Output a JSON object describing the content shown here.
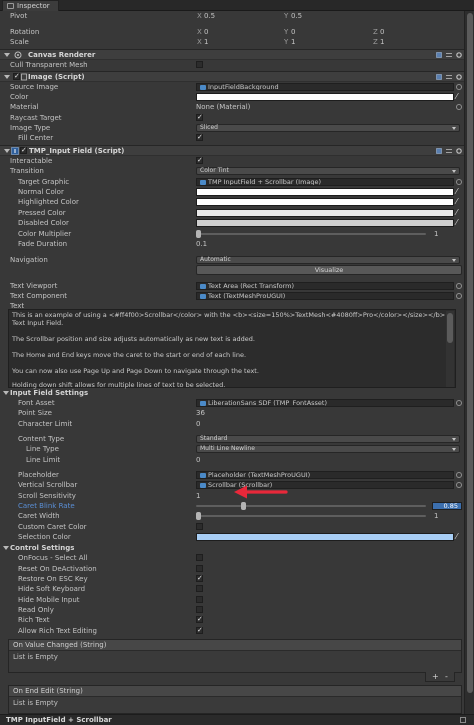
{
  "window": {
    "tab_label": "Inspector"
  },
  "transform": {
    "pivot": {
      "label": "Pivot",
      "x": "0.5",
      "y": "0.5"
    },
    "rotation": {
      "label": "Rotation",
      "x": "0",
      "y": "0",
      "z": "0"
    },
    "scale": {
      "label": "Scale",
      "x": "1",
      "y": "1",
      "z": "1"
    },
    "axis_x": "X",
    "axis_y": "Y",
    "axis_z": "Z"
  },
  "canvas_renderer": {
    "title": "Canvas Renderer",
    "cull_label": "Cull Transparent Mesh"
  },
  "image": {
    "title": "Image (Script)",
    "source_image_label": "Source Image",
    "source_image_value": "InputFieldBackground",
    "color_label": "Color",
    "material_label": "Material",
    "material_value": "None (Material)",
    "raycast_label": "Raycast Target",
    "image_type_label": "Image Type",
    "image_type_value": "Sliced",
    "fill_center_label": "Fill Center"
  },
  "tmp_input": {
    "title": "TMP_Input Field (Script)",
    "interactable_label": "Interactable",
    "transition_label": "Transition",
    "transition_value": "Color Tint",
    "target_graphic_label": "Target Graphic",
    "target_graphic_value": "TMP InputField + Scrollbar (Image)",
    "normal_color_label": "Normal Color",
    "highlighted_color_label": "Highlighted Color",
    "pressed_color_label": "Pressed Color",
    "disabled_color_label": "Disabled Color",
    "color_multiplier_label": "Color Multiplier",
    "color_multiplier_value": "1",
    "fade_duration_label": "Fade Duration",
    "fade_duration_value": "0.1",
    "navigation_label": "Navigation",
    "navigation_value": "Automatic",
    "visualize_label": "Visualize",
    "text_viewport_label": "Text Viewport",
    "text_viewport_value": "Text Area (Rect Transform)",
    "text_component_label": "Text Component",
    "text_component_value": "Text (TextMeshProUGUI)",
    "text_label": "Text",
    "text_lines": [
      "This is an example of using a <#ff4f00>Scrollbar</color> with the <b><size=150%>TextMesh<#4080ff>Pro</color></size></b>",
      "Text Input Field.",
      "",
      "The Scrollbar position and size adjusts automatically as new text is added.",
      "",
      "The Home and End keys move the caret to the start or end of each line.",
      "",
      "You can now also use Page Up and Page Down to navigate through the text.",
      "",
      "Holding down shift allows for multiple lines of text to be selected."
    ]
  },
  "input_settings": {
    "title": "Input Field Settings",
    "font_asset_label": "Font Asset",
    "font_asset_value": "LiberationSans SDF (TMP_FontAsset)",
    "point_size_label": "Point Size",
    "point_size_value": "36",
    "char_limit_label": "Character Limit",
    "char_limit_value": "0",
    "content_type_label": "Content Type",
    "content_type_value": "Standard",
    "line_type_label": "Line Type",
    "line_type_value": "Multi Line Newline",
    "line_limit_label": "Line Limit",
    "line_limit_value": "0",
    "placeholder_label": "Placeholder",
    "placeholder_value": "Placeholder (TextMeshProUGUI)",
    "vertical_scrollbar_label": "Vertical Scrollbar",
    "vertical_scrollbar_value": "Scrollbar (Scrollbar)",
    "scroll_sensitivity_label": "Scroll Sensitivity",
    "scroll_sensitivity_value": "1",
    "caret_blink_label": "Caret Blink Rate",
    "caret_blink_value": "0.85",
    "caret_blink_fraction": 0.2,
    "caret_width_label": "Caret Width",
    "caret_width_value": "1",
    "custom_caret_label": "Custom Caret Color",
    "selection_color_label": "Selection Color"
  },
  "control_settings": {
    "title": "Control Settings",
    "onfocus_label": "OnFocus - Select All",
    "reset_label": "Reset On DeActivation",
    "restore_label": "Restore On ESC Key",
    "hide_soft_label": "Hide Soft Keyboard",
    "hide_mobile_label": "Hide Mobile Input",
    "read_only_label": "Read Only",
    "rich_text_label": "Rich Text",
    "allow_rich_label": "Allow Rich Text Editing"
  },
  "events": {
    "on_value_changed_title": "On Value Changed (String)",
    "on_end_edit_title": "On End Edit (String)",
    "list_empty": "List is Empty",
    "plus": "+",
    "minus": "-"
  },
  "footer": {
    "title": "TMP InputField + Scrollbar"
  },
  "colors": {
    "selection": "#a8cef5",
    "accent": "#3c6fae",
    "arrow": "#e8283a"
  }
}
